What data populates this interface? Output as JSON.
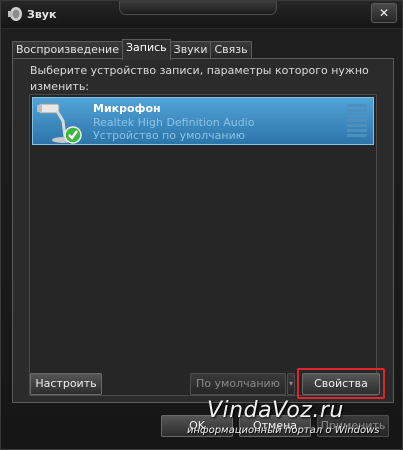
{
  "window": {
    "title": "Звук",
    "close_label": "✕"
  },
  "tabs": [
    {
      "label": "Воспроизведение",
      "active": false
    },
    {
      "label": "Запись",
      "active": true
    },
    {
      "label": "Звуки",
      "active": false
    },
    {
      "label": "Связь",
      "active": false
    }
  ],
  "instruction": "Выберите устройство записи, параметры которого нужно изменить:",
  "devices": [
    {
      "name": "Микрофон",
      "driver": "Realtek High Definition Audio",
      "status": "Устройство по умолчанию",
      "icon": "microphone-icon",
      "default": true,
      "selected": true
    }
  ],
  "buttons": {
    "configure": "Настроить",
    "set_default": "По умолчанию",
    "properties": "Свойства",
    "ok": "OK",
    "cancel": "Отмена",
    "apply": "Применить"
  },
  "watermark": {
    "main": "VindaVoz.ru",
    "sub": "информационный портал о Windows"
  },
  "colors": {
    "selection": "#3a8ac4",
    "highlight": "#e0242c",
    "background": "#2b2b2b"
  }
}
